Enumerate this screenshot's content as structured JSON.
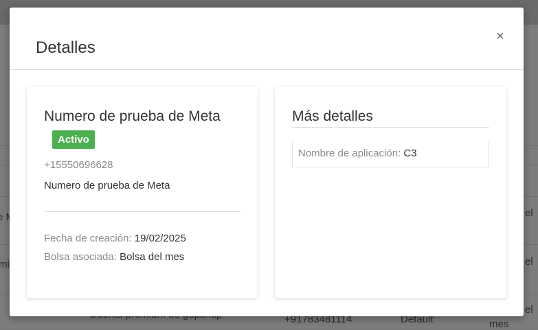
{
  "background": {
    "row_fragments": [
      {
        "left_text": "e M",
        "right_text": "el"
      },
      {
        "left_text": "mi",
        "right_text": "el"
      },
      {
        "left_text": "",
        "right_text": "el"
      }
    ],
    "bottom_row": {
      "account": "Cuenta premium de gupshup",
      "phone": "+91783481114",
      "bag": "Default",
      "right_text": "mes"
    }
  },
  "modal": {
    "title": "Detalles",
    "close_glyph": "×",
    "left_card": {
      "name": "Numero de prueba de Meta",
      "status": "Activo",
      "phone": "+15550696628",
      "description": "Numero de prueba de Meta",
      "created_label": "Fecha de creación:",
      "created_value": "19/02/2025",
      "bag_label": "Bolsa asociada:",
      "bag_value": "Bolsa del mes"
    },
    "right_card": {
      "title": "Más detalles",
      "app_label": "Nombre de aplicación:",
      "app_value": "C3"
    }
  },
  "colors": {
    "status_green": "#4caf50",
    "overlay": "#7d7d7d"
  }
}
